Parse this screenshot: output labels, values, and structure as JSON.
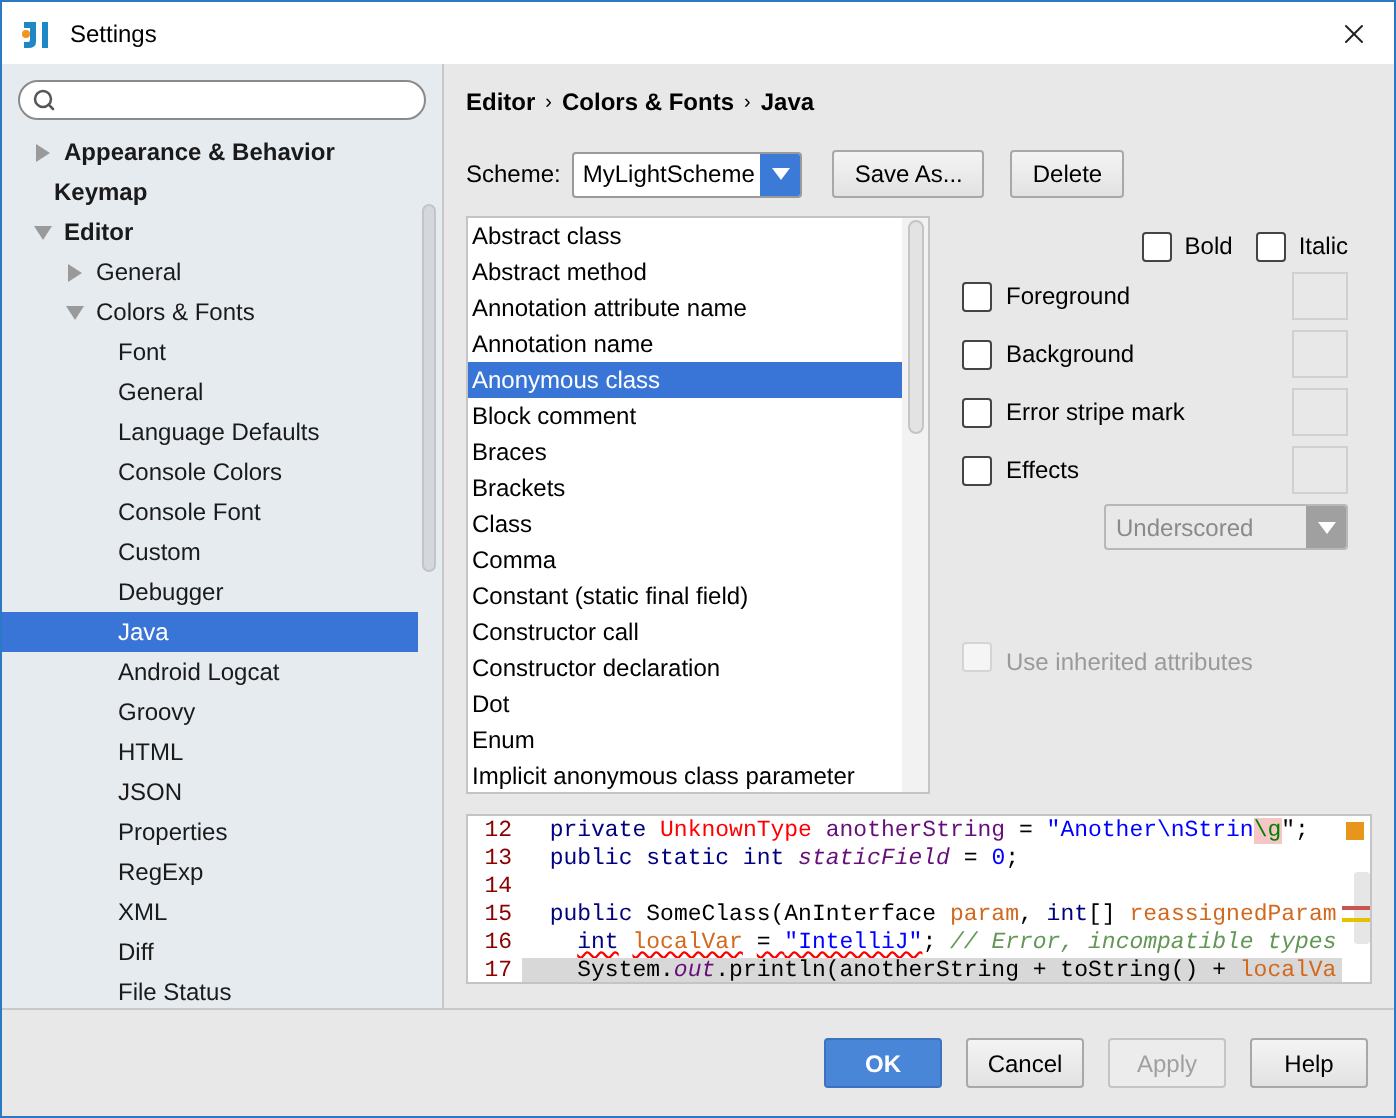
{
  "window": {
    "title": "Settings"
  },
  "tree": [
    {
      "label": "Appearance & Behavior",
      "expanded": false,
      "selected": false
    },
    {
      "label": "Keymap",
      "selected": false
    },
    {
      "label": "Editor",
      "expanded": true,
      "selected": false,
      "children": [
        {
          "label": "General",
          "expanded": false,
          "selected": false
        },
        {
          "label": "Colors & Fonts",
          "expanded": true,
          "selected": false,
          "children": [
            {
              "label": "Font",
              "selected": false
            },
            {
              "label": "General",
              "selected": false
            },
            {
              "label": "Language Defaults",
              "selected": false
            },
            {
              "label": "Console Colors",
              "selected": false
            },
            {
              "label": "Console Font",
              "selected": false
            },
            {
              "label": "Custom",
              "selected": false
            },
            {
              "label": "Debugger",
              "selected": false
            },
            {
              "label": "Java",
              "selected": true
            },
            {
              "label": "Android Logcat",
              "selected": false
            },
            {
              "label": "Groovy",
              "selected": false
            },
            {
              "label": "HTML",
              "selected": false
            },
            {
              "label": "JSON",
              "selected": false
            },
            {
              "label": "Properties",
              "selected": false
            },
            {
              "label": "RegExp",
              "selected": false
            },
            {
              "label": "XML",
              "selected": false
            },
            {
              "label": "Diff",
              "selected": false
            },
            {
              "label": "File Status",
              "selected": false
            }
          ]
        }
      ]
    }
  ],
  "breadcrumb": {
    "separator": "›",
    "items": [
      "Editor",
      "Colors & Fonts",
      "Java"
    ]
  },
  "scheme": {
    "label": "Scheme:",
    "value": "MyLightScheme",
    "buttons": [
      "Save As...",
      "Delete"
    ]
  },
  "attributes": [
    {
      "label": "Abstract class",
      "selected": false
    },
    {
      "label": "Abstract method",
      "selected": false
    },
    {
      "label": "Annotation attribute name",
      "selected": false
    },
    {
      "label": "Annotation name",
      "selected": false
    },
    {
      "label": "Anonymous class",
      "selected": true
    },
    {
      "label": "Block comment",
      "selected": false
    },
    {
      "label": "Braces",
      "selected": false
    },
    {
      "label": "Brackets",
      "selected": false
    },
    {
      "label": "Class",
      "selected": false
    },
    {
      "label": "Comma",
      "selected": false
    },
    {
      "label": "Constant (static final field)",
      "selected": false
    },
    {
      "label": "Constructor call",
      "selected": false
    },
    {
      "label": "Constructor declaration",
      "selected": false
    },
    {
      "label": "Dot",
      "selected": false
    },
    {
      "label": "Enum",
      "selected": false
    },
    {
      "label": "Implicit anonymous class parameter",
      "selected": false
    }
  ],
  "font_style": [
    {
      "label": "Bold",
      "checked": false
    },
    {
      "label": "Italic",
      "checked": false
    }
  ],
  "colors": [
    {
      "label": "Foreground",
      "checked": false
    },
    {
      "label": "Background",
      "checked": false
    },
    {
      "label": "Error stripe mark",
      "checked": false
    },
    {
      "label": "Effects",
      "checked": false
    }
  ],
  "effect_type": {
    "value": "Underscored",
    "disabled": true
  },
  "inherit": {
    "label": "Use inherited attributes",
    "checked": false,
    "disabled": true
  },
  "preview": [
    {
      "number": "12",
      "highlighted": false,
      "segments": [
        {
          "text": "  private",
          "kind": "keyword"
        },
        {
          "text": " UnknownType",
          "kind": "error_type"
        },
        {
          "text": " anotherString",
          "kind": "field"
        },
        {
          "text": " = ",
          "kind": "plain"
        },
        {
          "text": "\"Another\\nStrin",
          "kind": "string"
        },
        {
          "text": "\\g",
          "kind": "invalid_escape"
        },
        {
          "text": "\";",
          "kind": "plain"
        }
      ]
    },
    {
      "number": "13",
      "highlighted": false,
      "segments": [
        {
          "text": "  public static int",
          "kind": "keyword"
        },
        {
          "text": " staticField",
          "kind": "static_field"
        },
        {
          "text": " = ",
          "kind": "plain"
        },
        {
          "text": "0",
          "kind": "number"
        },
        {
          "text": ";",
          "kind": "plain"
        }
      ]
    },
    {
      "number": "14",
      "highlighted": false
    },
    {
      "number": "15",
      "highlighted": false,
      "segments": [
        {
          "text": "  public",
          "kind": "keyword"
        },
        {
          "text": " SomeClass(AnInterface ",
          "kind": "plain"
        },
        {
          "text": "param",
          "kind": "param"
        },
        {
          "text": ", ",
          "kind": "plain"
        },
        {
          "text": "int",
          "kind": "keyword"
        },
        {
          "text": "[] ",
          "kind": "plain"
        },
        {
          "text": "reassignedParam",
          "kind": "param"
        }
      ]
    },
    {
      "number": "16",
      "highlighted": false,
      "segments": [
        {
          "text": "    int",
          "kind": "keyword",
          "wavy": true
        },
        {
          "text": " localVar",
          "kind": "local",
          "wavy": true
        },
        {
          "text": " = ",
          "kind": "plain",
          "wavy": true
        },
        {
          "text": "\"IntelliJ\"",
          "kind": "string",
          "wavy": true
        },
        {
          "text": "; ",
          "kind": "plain"
        },
        {
          "text": "// Error, incompatible types",
          "kind": "comment"
        }
      ]
    },
    {
      "number": "17",
      "highlighted": true,
      "segments": [
        {
          "text": "    System.",
          "kind": "plain"
        },
        {
          "text": "out",
          "kind": "static_field"
        },
        {
          "text": ".println(anotherString + toString() + ",
          "kind": "plain"
        },
        {
          "text": "localVa",
          "kind": "local"
        }
      ]
    }
  ],
  "footer_buttons": [
    {
      "label": "OK",
      "kind": "primary",
      "disabled": false
    },
    {
      "label": "Cancel",
      "kind": "normal",
      "disabled": false
    },
    {
      "label": "Apply",
      "kind": "normal",
      "disabled": true
    },
    {
      "label": "Help",
      "kind": "normal",
      "disabled": false
    }
  ]
}
